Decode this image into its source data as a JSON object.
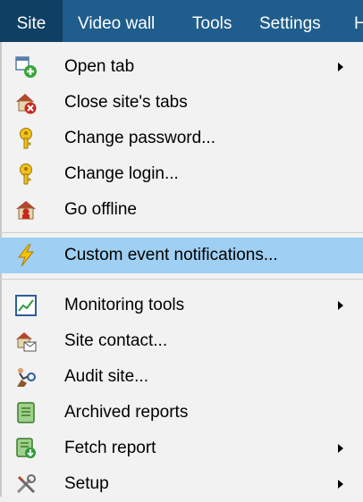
{
  "menubar": {
    "items": [
      {
        "label": "Site"
      },
      {
        "label": "Video wall"
      },
      {
        "label": "Tools"
      },
      {
        "label": "Settings"
      },
      {
        "label": "H"
      }
    ]
  },
  "site_menu": {
    "items": [
      {
        "label": "Open tab",
        "icon": "open-tab-icon",
        "submenu": true
      },
      {
        "label": "Close site's tabs",
        "icon": "close-site-tabs-icon"
      },
      {
        "label": "Change password...",
        "icon": "key-icon"
      },
      {
        "label": "Change login...",
        "icon": "key-icon"
      },
      {
        "label": "Go offline",
        "icon": "go-offline-icon"
      },
      {
        "label": "Custom event notifications...",
        "icon": "lightning-icon",
        "highlighted": true
      },
      {
        "label": "Monitoring tools",
        "icon": "monitoring-chart-icon",
        "submenu": true
      },
      {
        "label": "Site contact...",
        "icon": "site-contact-icon"
      },
      {
        "label": "Audit site...",
        "icon": "audit-icon"
      },
      {
        "label": "Archived reports",
        "icon": "archived-reports-icon"
      },
      {
        "label": "Fetch report",
        "icon": "fetch-report-icon",
        "submenu": true
      },
      {
        "label": "Setup",
        "icon": "setup-tools-icon",
        "submenu": true
      }
    ]
  },
  "colors": {
    "menubar_bg": "#1f5e8c",
    "active_menubar_bg": "#0f3f63",
    "highlight_bg": "#9fcff2",
    "menu_bg": "#f2f2f2"
  }
}
